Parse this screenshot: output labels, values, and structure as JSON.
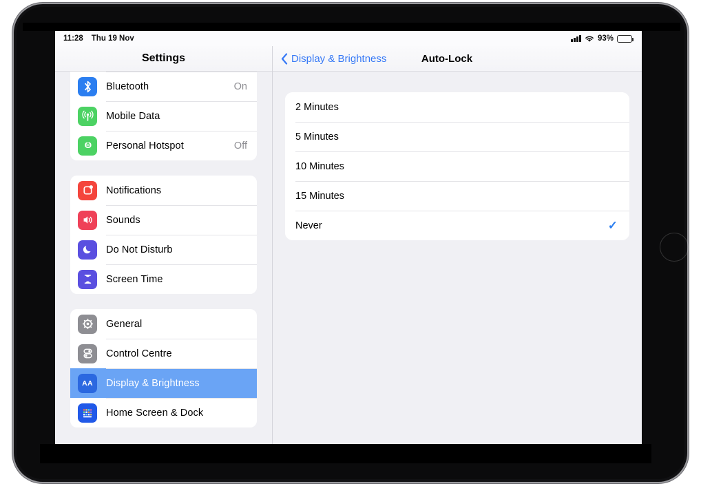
{
  "status_bar": {
    "time": "11:28",
    "date": "Thu 19 Nov",
    "signal_icon": "cellular-signal-icon",
    "wifi_icon": "wifi-icon",
    "battery_percent": "93%",
    "battery_icon": "battery-icon"
  },
  "sidebar": {
    "title": "Settings",
    "groups": [
      {
        "name": "connectivity",
        "items": [
          {
            "label": "",
            "value": "",
            "icon": "wifi-settings-icon",
            "clipped": true,
            "selected": false
          },
          {
            "label": "Bluetooth",
            "value": "On",
            "icon": "bluetooth-icon",
            "selected": false
          },
          {
            "label": "Mobile Data",
            "value": "",
            "icon": "mobile-data-icon",
            "selected": false
          },
          {
            "label": "Personal Hotspot",
            "value": "Off",
            "icon": "personal-hotspot-icon",
            "selected": false
          }
        ]
      },
      {
        "name": "alerts",
        "items": [
          {
            "label": "Notifications",
            "value": "",
            "icon": "notifications-icon",
            "selected": false
          },
          {
            "label": "Sounds",
            "value": "",
            "icon": "sounds-icon",
            "selected": false
          },
          {
            "label": "Do Not Disturb",
            "value": "",
            "icon": "do-not-disturb-icon",
            "selected": false
          },
          {
            "label": "Screen Time",
            "value": "",
            "icon": "screen-time-icon",
            "selected": false
          }
        ]
      },
      {
        "name": "system",
        "items": [
          {
            "label": "General",
            "value": "",
            "icon": "general-icon",
            "selected": false
          },
          {
            "label": "Control Centre",
            "value": "",
            "icon": "control-centre-icon",
            "selected": false
          },
          {
            "label": "Display & Brightness",
            "value": "",
            "icon": "display-brightness-icon",
            "selected": true
          },
          {
            "label": "Home Screen & Dock",
            "value": "",
            "icon": "home-screen-dock-icon",
            "selected": false
          }
        ]
      }
    ]
  },
  "detail": {
    "back_label": "Display & Brightness",
    "back_icon": "chevron-left-icon",
    "title": "Auto-Lock",
    "checkmark_glyph": "✓",
    "options": [
      {
        "label": "2 Minutes",
        "selected": false
      },
      {
        "label": "5 Minutes",
        "selected": false
      },
      {
        "label": "10 Minutes",
        "selected": false
      },
      {
        "label": "15 Minutes",
        "selected": false
      },
      {
        "label": "Never",
        "selected": true
      }
    ]
  },
  "colors": {
    "accent_blue": "#3578f6",
    "selected_row": "#6aa4f5",
    "checkmark": "#2b7ef0",
    "background": "#f0f0f4",
    "card": "#ffffff",
    "secondary_text": "#8e8e93"
  }
}
